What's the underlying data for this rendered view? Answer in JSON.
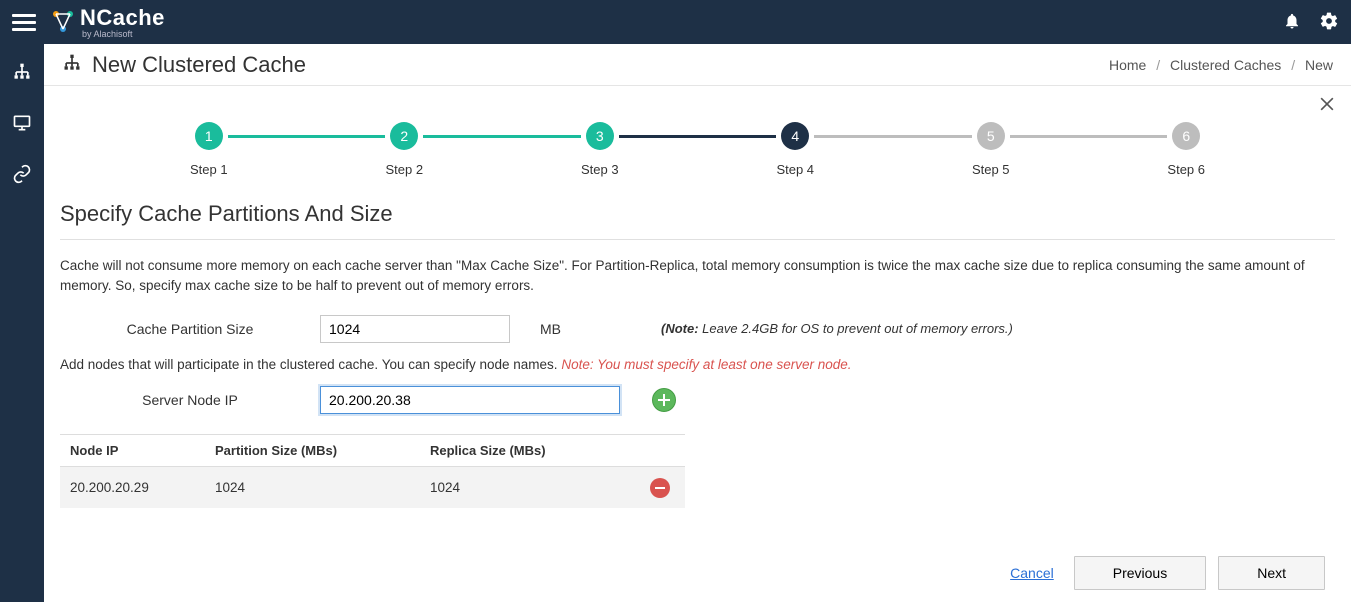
{
  "brand": {
    "name": "NCache",
    "byline": "by Alachisoft"
  },
  "page": {
    "title": "New Clustered Cache",
    "breadcrumb": [
      "Home",
      "Clustered Caches",
      "New"
    ]
  },
  "stepper": {
    "steps": [
      {
        "num": "1",
        "label": "Step 1",
        "state": "done"
      },
      {
        "num": "2",
        "label": "Step 2",
        "state": "done"
      },
      {
        "num": "3",
        "label": "Step 3",
        "state": "done"
      },
      {
        "num": "4",
        "label": "Step 4",
        "state": "active"
      },
      {
        "num": "5",
        "label": "Step 5",
        "state": "future"
      },
      {
        "num": "6",
        "label": "Step 6",
        "state": "future"
      }
    ]
  },
  "section": {
    "heading": "Specify Cache Partitions And Size",
    "description": "Cache will not consume more memory on each cache server than \"Max Cache Size\". For Partition-Replica, total memory consumption is twice the max cache size due to replica consuming the same amount of memory. So, specify max cache size to be half to prevent out of memory errors."
  },
  "form": {
    "partition_size_label": "Cache Partition Size",
    "partition_size_value": "1024",
    "partition_size_unit": "MB",
    "note_prefix": "(Note:",
    "note_body": " Leave 2.4GB for OS to prevent out of memory errors.)",
    "add_nodes_text": "Add nodes that will participate in the clustered cache. You can specify node names. ",
    "add_nodes_warn": "Note: You must specify at least one server node.",
    "server_ip_label": "Server Node IP",
    "server_ip_value": "20.200.20.38"
  },
  "table": {
    "headers": [
      "Node IP",
      "Partition Size (MBs)",
      "Replica Size (MBs)",
      ""
    ],
    "rows": [
      {
        "ip": "20.200.20.29",
        "partition": "1024",
        "replica": "1024"
      }
    ]
  },
  "footer": {
    "cancel": "Cancel",
    "previous": "Previous",
    "next": "Next"
  }
}
